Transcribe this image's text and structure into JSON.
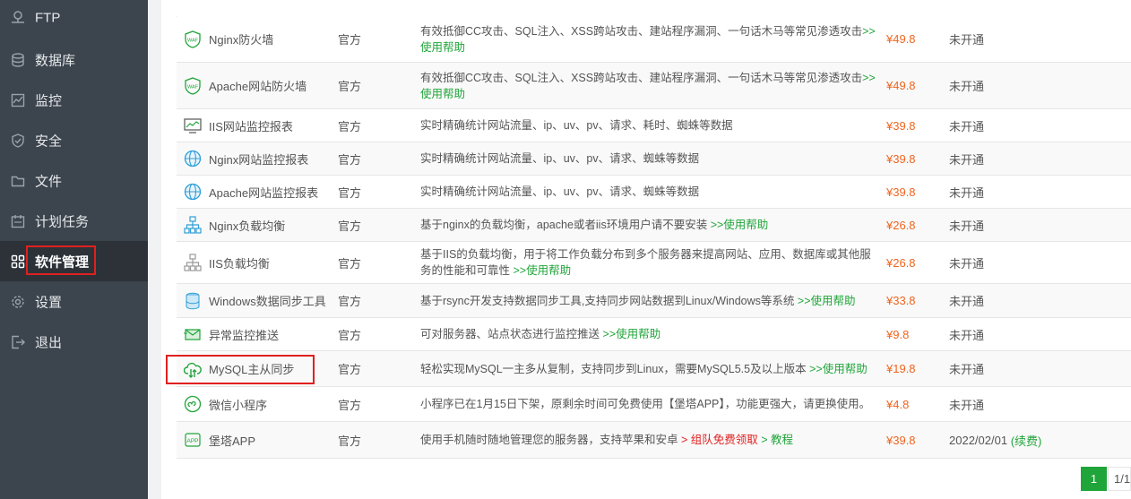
{
  "sidebar": {
    "items": [
      {
        "label": "FTP",
        "icon": "ftp-icon"
      },
      {
        "label": "数据库",
        "icon": "database-icon"
      },
      {
        "label": "监控",
        "icon": "monitor-icon"
      },
      {
        "label": "安全",
        "icon": "shield-icon"
      },
      {
        "label": "文件",
        "icon": "folder-icon"
      },
      {
        "label": "计划任务",
        "icon": "calendar-icon"
      },
      {
        "label": "软件管理",
        "icon": "grid-icon"
      },
      {
        "label": "设置",
        "icon": "gear-icon"
      },
      {
        "label": "退出",
        "icon": "logout-icon"
      }
    ]
  },
  "table": {
    "rows": [
      {
        "name": "Nginx防火墙",
        "dev": "官方",
        "desc": "有效抵御CC攻击、SQL注入、XSS跨站攻击、建站程序漏洞、一句话木马等常见渗透攻击",
        "help": ">>使用帮助",
        "price": "¥49.8",
        "expire": "未开通",
        "icon": "waf-icon"
      },
      {
        "name": "Apache网站防火墙",
        "dev": "官方",
        "desc": "有效抵御CC攻击、SQL注入、XSS跨站攻击、建站程序漏洞、一句话木马等常见渗透攻击",
        "help": ">>使用帮助",
        "price": "¥49.8",
        "expire": "未开通",
        "icon": "waf-icon"
      },
      {
        "name": "IIS网站监控报表",
        "dev": "官方",
        "desc": "实时精确统计网站流量、ip、uv、pv、请求、耗时、蜘蛛等数据",
        "help": "",
        "price": "¥39.8",
        "expire": "未开通",
        "icon": "chart-monitor-icon"
      },
      {
        "name": "Nginx网站监控报表",
        "dev": "官方",
        "desc": "实时精确统计网站流量、ip、uv、pv、请求、蜘蛛等数据",
        "help": "",
        "price": "¥39.8",
        "expire": "未开通",
        "icon": "globe-icon"
      },
      {
        "name": "Apache网站监控报表",
        "dev": "官方",
        "desc": "实时精确统计网站流量、ip、uv、pv、请求、蜘蛛等数据",
        "help": "",
        "price": "¥39.8",
        "expire": "未开通",
        "icon": "globe-icon"
      },
      {
        "name": "Nginx负载均衡",
        "dev": "官方",
        "desc": "基于nginx的负载均衡，apache或者iis环境用户请不要安装",
        "help": ">>使用帮助",
        "price": "¥26.8",
        "expire": "未开通",
        "icon": "network-icon"
      },
      {
        "name": "IIS负载均衡",
        "dev": "官方",
        "desc": "基于IIS的负载均衡，用于将工作负载分布到多个服务器来提高网站、应用、数据库或其他服务的性能和可靠性",
        "help": ">>使用帮助",
        "price": "¥26.8",
        "expire": "未开通",
        "icon": "network-icon"
      },
      {
        "name": "Windows数据同步工具",
        "dev": "官方",
        "desc": "基于rsync开发支持数据同步工具,支持同步网站数据到Linux/Windows等系统",
        "help": ">>使用帮助",
        "price": "¥33.8",
        "expire": "未开通",
        "icon": "db-sync-icon"
      },
      {
        "name": "异常监控推送",
        "dev": "官方",
        "desc": "可对服务器、站点状态进行监控推送",
        "help": ">>使用帮助",
        "price": "¥9.8",
        "expire": "未开通",
        "icon": "mail-push-icon"
      },
      {
        "name": "MySQL主从同步",
        "dev": "官方",
        "desc": "轻松实现MySQL一主多从复制，支持同步到Linux，需要MySQL5.5及以上版本",
        "help": ">>使用帮助",
        "price": "¥19.8",
        "expire": "未开通",
        "icon": "cloud-sync-icon"
      },
      {
        "name": "微信小程序",
        "dev": "官方",
        "desc": "小程序已在1月15日下架，原剩余时间可免费使用【堡塔APP】，功能更强大，请更换使用。",
        "help": "",
        "price": "¥4.8",
        "expire": "未开通",
        "icon": "miniapp-icon"
      },
      {
        "name": "堡塔APP",
        "dev": "官方",
        "desc": "使用手机随时随地管理您的服务器，支持苹果和安卓",
        "help": "",
        "price": "¥39.8",
        "expire": "2022/02/01",
        "icon": "app-icon"
      }
    ],
    "app_extra": {
      "promo": "> 组队免费领取",
      "tutorial": "> 教程",
      "renew": "(续费)"
    }
  },
  "pagination": {
    "current": "1",
    "total": "1/1"
  },
  "colors": {
    "sidebar_bg": "#3c444d",
    "accent_green": "#20a53a",
    "price_orange": "#f0641e",
    "highlight_red": "#e02020"
  }
}
